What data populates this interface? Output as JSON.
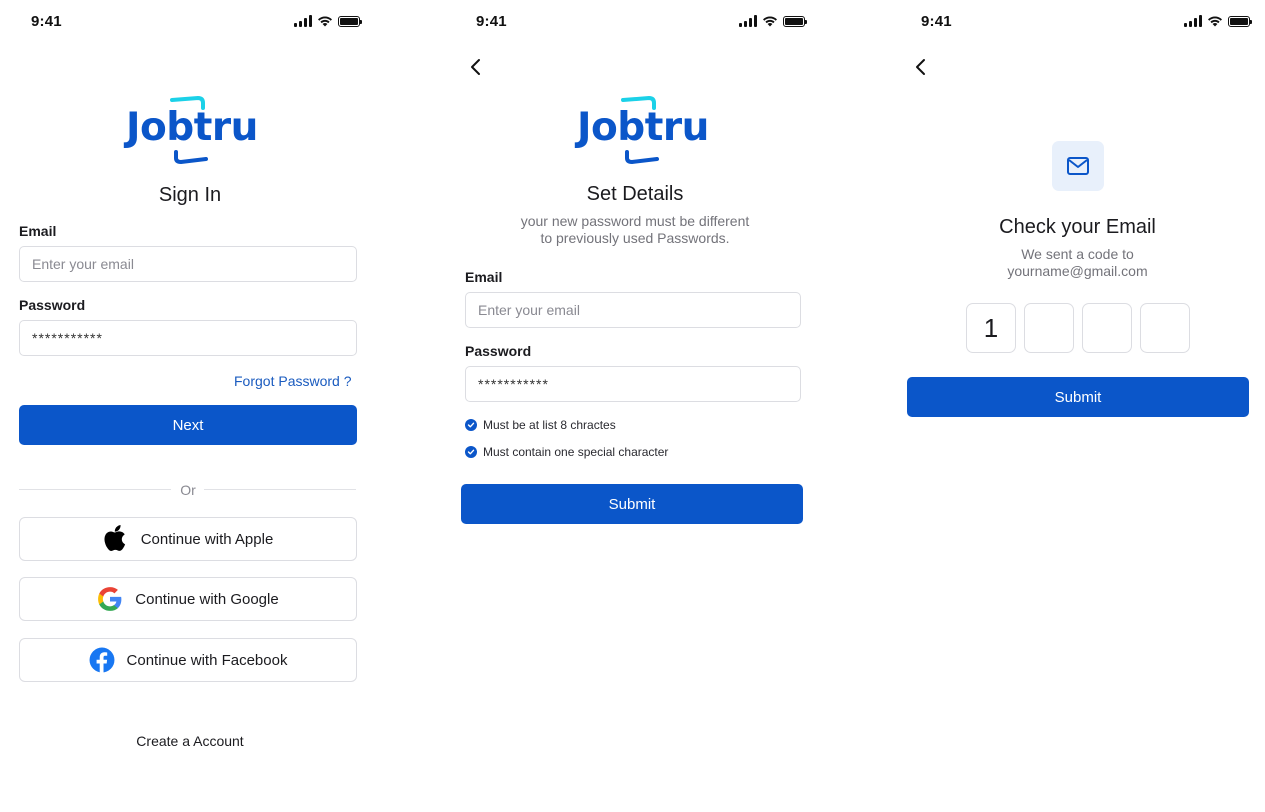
{
  "status_bar": {
    "time": "9:41"
  },
  "brand": {
    "logo_text": "Jobtru",
    "primary_color": "#0b56c9",
    "accent_color": "#1bd1e8"
  },
  "sign_in": {
    "title": "Sign In",
    "email_label": "Email",
    "email_placeholder": "Enter your email",
    "password_label": "Password",
    "password_value": "***********",
    "forgot_password": "Forgot Password ?",
    "next_button": "Next",
    "or_text": "Or",
    "social": [
      {
        "label": "Continue with Apple",
        "icon": "apple-icon"
      },
      {
        "label": "Continue with Google",
        "icon": "google-icon"
      },
      {
        "label": "Continue with Facebook",
        "icon": "facebook-icon"
      }
    ],
    "create_account": "Create a Account"
  },
  "set_details": {
    "title": "Set Details",
    "subtitle_line1": "your new password  must be different",
    "subtitle_line2": "to previously used Passwords.",
    "email_label": "Email",
    "email_placeholder": "Enter your email",
    "password_label": "Password",
    "password_value": "***********",
    "rules": [
      "Must be at list 8 chractes",
      "Must contain one special character"
    ],
    "submit_button": "Submit"
  },
  "check_email": {
    "title": "Check your Email",
    "subtitle_line1": "We sent a code to",
    "subtitle_line2": "yourname@gmail.com",
    "otp_digits": [
      "1",
      "",
      "",
      ""
    ],
    "submit_button": "Submit"
  }
}
